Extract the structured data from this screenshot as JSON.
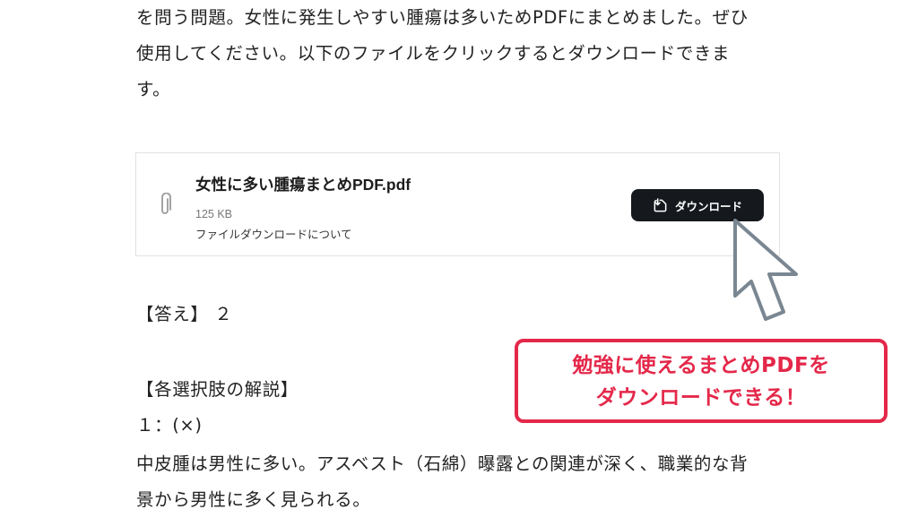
{
  "intro": {
    "lines": [
      "を問う問題。女性に発生しやすい腫瘍は多いためPDFにまとめました。ぜひ",
      "使用してください。以下のファイルをクリックするとダウンロードできま",
      "す。"
    ]
  },
  "file_card": {
    "file_name": "女性に多い腫瘍まとめPDF.pdf",
    "file_size": "125 KB",
    "about_link": "ファイルダウンロードについて",
    "download_label": "ダウンロード",
    "icons": {
      "attachment": "paperclip-icon",
      "download": "download-icon"
    }
  },
  "callout": {
    "lines": [
      "勉強に使えるまとめPDFを",
      "ダウンロードできる！"
    ],
    "color": "#e4284a"
  },
  "answer": {
    "text": "【答え】 ２"
  },
  "explanation": {
    "heading": "【各選択肢の解説】",
    "option_label": "１：(×)",
    "lines": [
      "中皮腫は男性に多い。アスベスト（石綿）曝露との関連が深く、職業的な背",
      "景から男性に多く見られる。"
    ]
  },
  "colors": {
    "button_bg": "#15191e",
    "text": "#222222",
    "accent": "#e4284a"
  }
}
